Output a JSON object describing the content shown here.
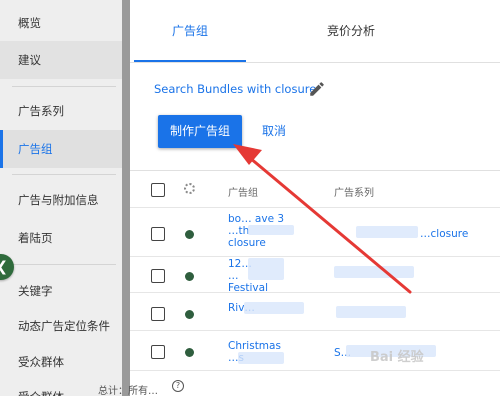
{
  "sidebar": {
    "items": [
      {
        "label": "概览"
      },
      {
        "label": "建议"
      },
      {
        "label": "广告系列"
      },
      {
        "label": "广告组"
      },
      {
        "label": "广告与附加信息"
      },
      {
        "label": "着陆页"
      },
      {
        "label": "关键字"
      },
      {
        "label": "动态广告定位条件"
      },
      {
        "label": "受众群体"
      },
      {
        "label": "受众群体"
      }
    ],
    "collapse_icon": "chevron-left-icon"
  },
  "tabs": [
    {
      "label": "广告组",
      "active": true
    },
    {
      "label": "竞价分析",
      "active": false
    }
  ],
  "search": {
    "link_label": "Search Bundles with closure",
    "icon": "pencil-icon"
  },
  "actions": {
    "create_label": "制作广告组",
    "cancel_label": "取消"
  },
  "table": {
    "headers": {
      "ad_group": "广告组",
      "campaign": "广告系列"
    },
    "rows": [
      {
        "ad_group": "bo… ave 3\n…th\nclosure",
        "campaign": "…closure",
        "status": "enabled"
      },
      {
        "ad_group": "12…\n…\nFestival",
        "campaign": "",
        "status": "enabled"
      },
      {
        "ad_group": "Riv…",
        "campaign": "",
        "status": "enabled"
      },
      {
        "ad_group": "Christmas\n…s",
        "campaign": "S…",
        "status": "enabled"
      }
    ],
    "footer": "总计：所有…",
    "help_icon": "help-circle-icon"
  },
  "annotation": {
    "arrow_color": "#e53935"
  },
  "watermark": "Bai 经验",
  "colors": {
    "accent": "#1a73e8",
    "sidebar_bg": "#eeeeee",
    "status_green": "#2f5e3e"
  }
}
